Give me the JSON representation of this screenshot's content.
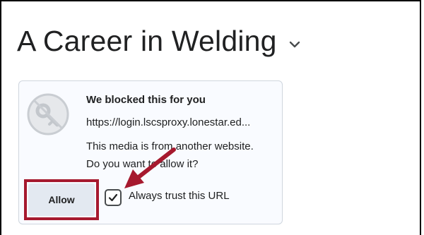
{
  "page": {
    "title": "A Career in Welding"
  },
  "blocked_media": {
    "icon": "blocked-key-icon",
    "heading": "We blocked this for you",
    "url": "https://login.lscsproxy.lonestar.ed...",
    "message_line1": "This media is from another website.",
    "message_line2": "Do you want to allow it?",
    "allow_label": "Allow",
    "trust_label": "Always trust this URL",
    "trust_checked": true
  },
  "colors": {
    "highlight": "#a6192e",
    "card_background": "#f9fbff",
    "button_background": "#e3e9f1"
  }
}
